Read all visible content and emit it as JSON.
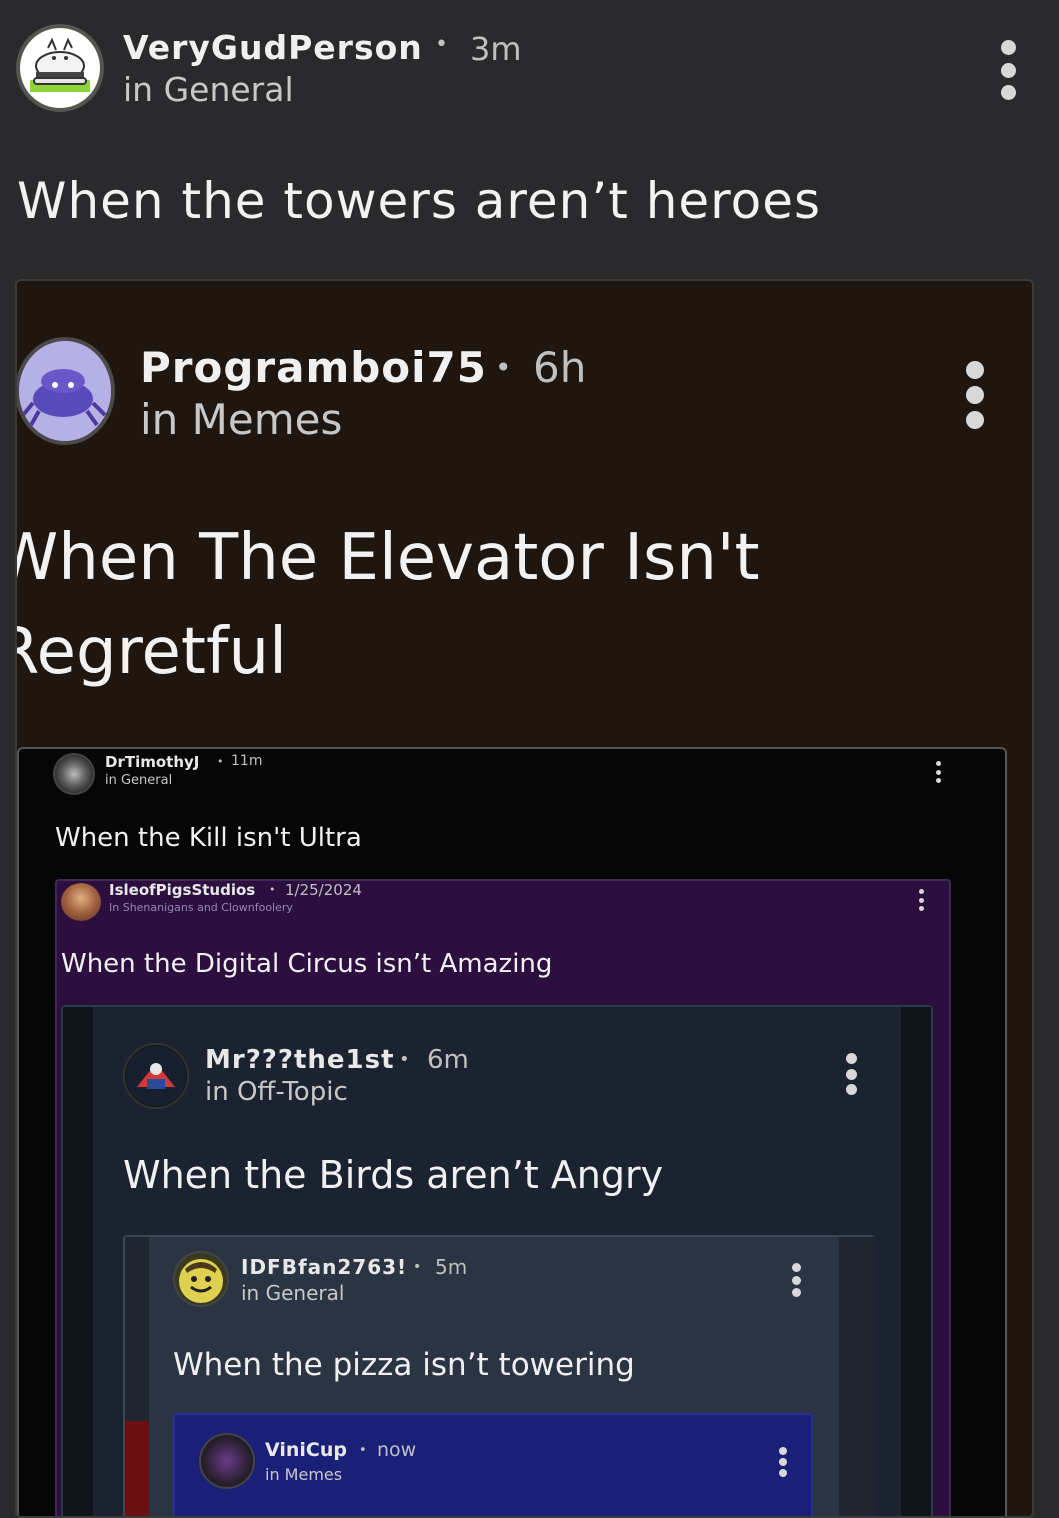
{
  "post": {
    "author": "VeryGudPerson",
    "separator": "•",
    "time": "3m",
    "community": "in General",
    "title": "When the towers aren’t heroes",
    "avatar_icon": "burger-cat-avatar-icon"
  },
  "embed1": {
    "author": "Programboi75",
    "separator": "•",
    "time": "6h",
    "community": "in Memes",
    "title_line1": "When The Elevator Isn't",
    "title_line2": "Regretful",
    "avatar_icon": "purple-crab-avatar-icon"
  },
  "embed2": {
    "author": "DrTimothyJ",
    "separator": "•",
    "time": "11m",
    "community": "in General",
    "title": "When the Kill isn't Ultra"
  },
  "embed3": {
    "author": "IsleofPigsStudios",
    "separator": "•",
    "time": "1/25/2024",
    "community": "In Shenanigans and Clownfoolery",
    "title": "When the Digital Circus isn’t Amazing"
  },
  "embed4": {
    "author": "Mr???the1st",
    "separator": "•",
    "time": "6m",
    "community": "in Off-Topic",
    "title": "When the Birds aren’t Angry"
  },
  "embed5": {
    "author": "IDFBfan2763!",
    "separator": "•",
    "time": "5m",
    "community": "in General",
    "title": "When the pizza isn’t towering"
  },
  "embed6": {
    "author": "ViniCup",
    "separator": "•",
    "time": "now",
    "community": "in Memes"
  },
  "colors": {
    "background": "#2a2a2c",
    "embed1_bg": "#1e160f",
    "embed2_bg": "#060606",
    "embed3_bg": "#2c0f3f",
    "embed4_bg": "#1b2230",
    "embed5_bg": "#2a3442",
    "embed6_bg": "#1a2078"
  }
}
